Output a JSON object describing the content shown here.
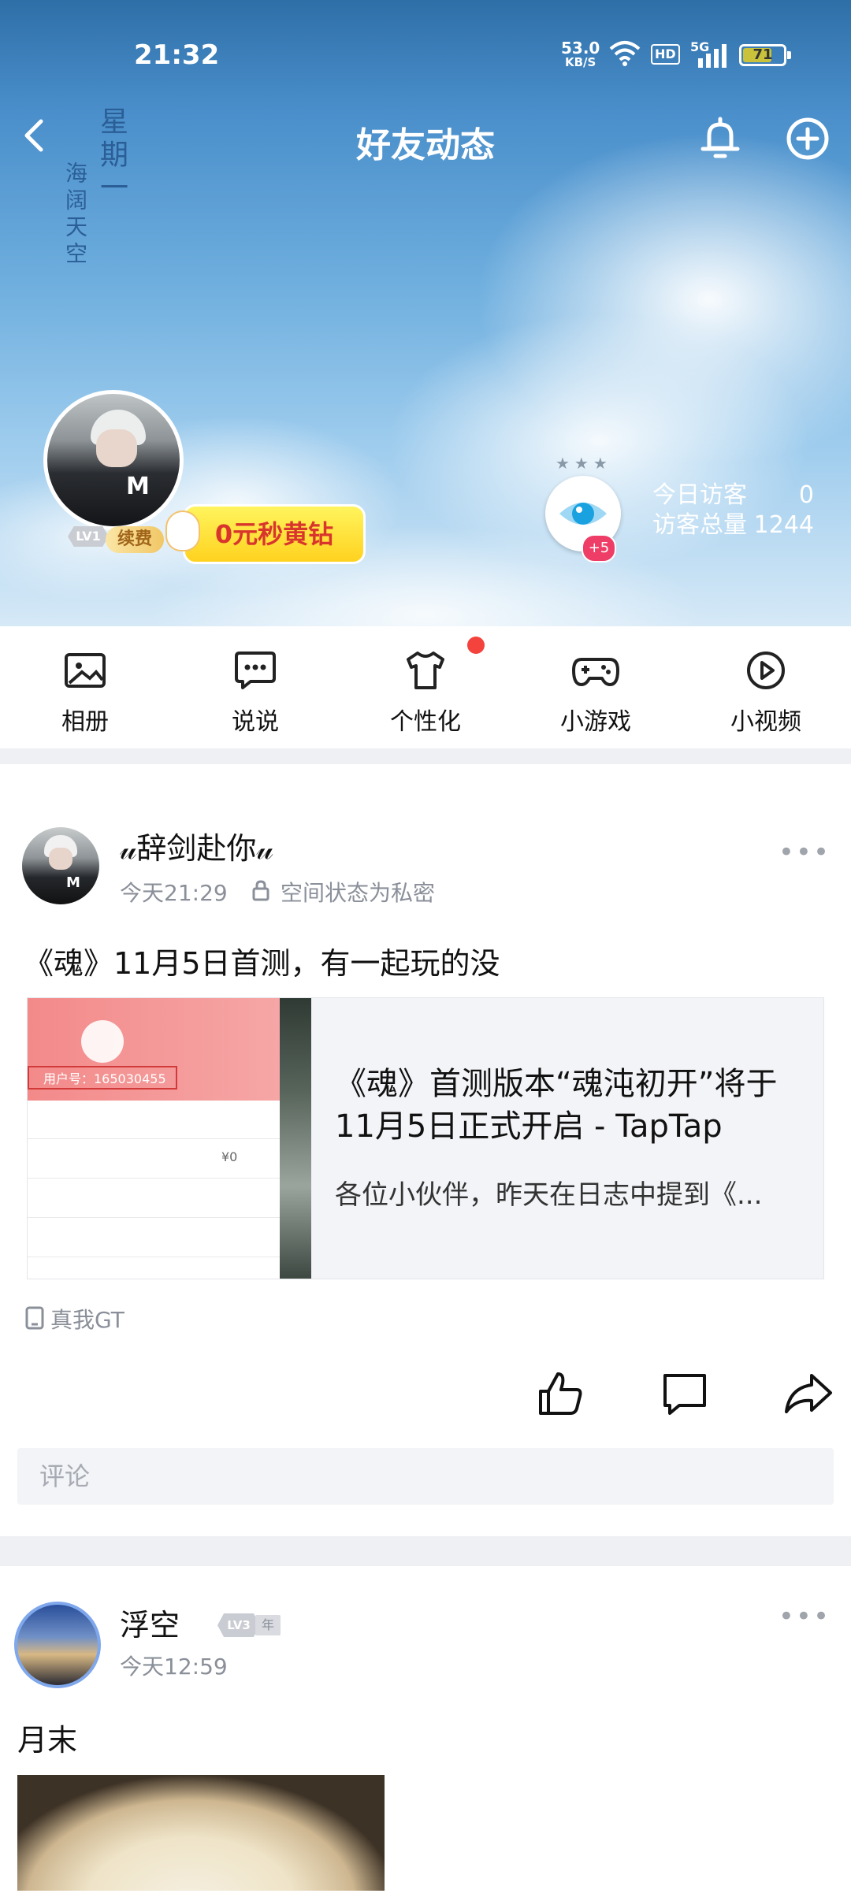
{
  "status_bar": {
    "time": "21:32",
    "net_speed_value": "53.0",
    "net_speed_unit": "KB/S",
    "network": "5G",
    "hd_label": "HD",
    "battery": "71",
    "battery_level": 0.71
  },
  "header": {
    "title": "好友动态",
    "back_icon": "chevron-left-icon",
    "bell_icon": "bell-icon",
    "add_icon": "plus-circle-icon"
  },
  "cover": {
    "deco_line1": "星期一",
    "deco_line2": "海阔天空",
    "level": "LV1",
    "renew": "续费",
    "promo": "0元秒黄钻",
    "visitor_badge": "+5",
    "today_visitors_label": "今日访客",
    "today_visitors": "0",
    "total_visitors_label": "访客总量",
    "total_visitors": "1244"
  },
  "quick_nav": [
    {
      "label": "相册",
      "icon": "photo-album-icon"
    },
    {
      "label": "说说",
      "icon": "message-dots-icon"
    },
    {
      "label": "个性化",
      "icon": "tshirt-icon"
    },
    {
      "label": "小游戏",
      "icon": "gamepad-icon"
    },
    {
      "label": "小视频",
      "icon": "play-circle-icon"
    }
  ],
  "posts": [
    {
      "username": "𝓊辞剑赴你𝓊",
      "time": "今天21:29",
      "privacy": "空间状态为私密",
      "text": "《魂》11月5日首测，有一起玩的没",
      "link": {
        "title": "《魂》首测版本“魂沌初开”将于11月5日正式开启 - TapTap",
        "desc": "各位小伙伴，昨天在日志中提到《...",
        "thumb_uid": "用户号：165030455",
        "thumb_price": "¥0"
      },
      "device": "真我GT",
      "comment_placeholder": "评论"
    },
    {
      "username": "浮空",
      "level": "LV3",
      "year_badge": "年",
      "time": "今天12:59",
      "text": "月末"
    }
  ],
  "colors": {
    "red_dot": "#f4433c",
    "promo_text": "#d8362c",
    "meta_gray": "#8a8f99"
  }
}
